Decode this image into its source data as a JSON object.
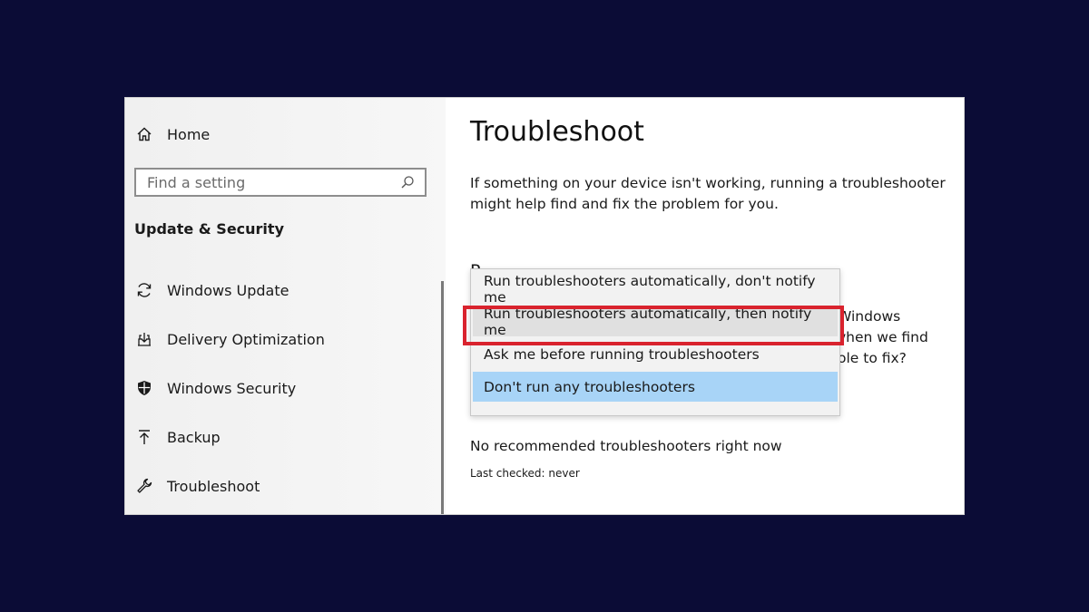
{
  "sidebar": {
    "home_label": "Home",
    "search_placeholder": "Find a setting",
    "section_title": "Update & Security",
    "items": [
      {
        "label": "Windows Update",
        "icon": "sync-icon"
      },
      {
        "label": "Delivery Optimization",
        "icon": "delivery-optimization-icon"
      },
      {
        "label": "Windows Security",
        "icon": "shield-icon"
      },
      {
        "label": "Backup",
        "icon": "backup-arrow-icon"
      },
      {
        "label": "Troubleshoot",
        "icon": "wrench-icon"
      }
    ]
  },
  "main": {
    "title": "Troubleshoot",
    "description": "If something on your device isn't working, running a troubleshooter might help find and fix the problem for you.",
    "hidden_heading_fragment": "R",
    "hidden_text_lines": [
      "Windows",
      "vhen we find",
      "ole to fix?"
    ],
    "status": "No recommended troubleshooters right now",
    "last_checked": "Last checked: never"
  },
  "dropdown": {
    "options": [
      {
        "label": "Run troubleshooters automatically, don't notify me",
        "state": "normal"
      },
      {
        "label": "Run troubleshooters automatically, then notify me",
        "state": "hover"
      },
      {
        "label": "Ask me before running troubleshooters",
        "state": "normal"
      },
      {
        "label": "Don't run any troubleshooters",
        "state": "selected"
      }
    ]
  },
  "colors": {
    "background": "#0b0c36",
    "highlight_border": "#d9232e",
    "selected_option": "#a8d4f7",
    "hover_option": "#e0e0e0"
  }
}
